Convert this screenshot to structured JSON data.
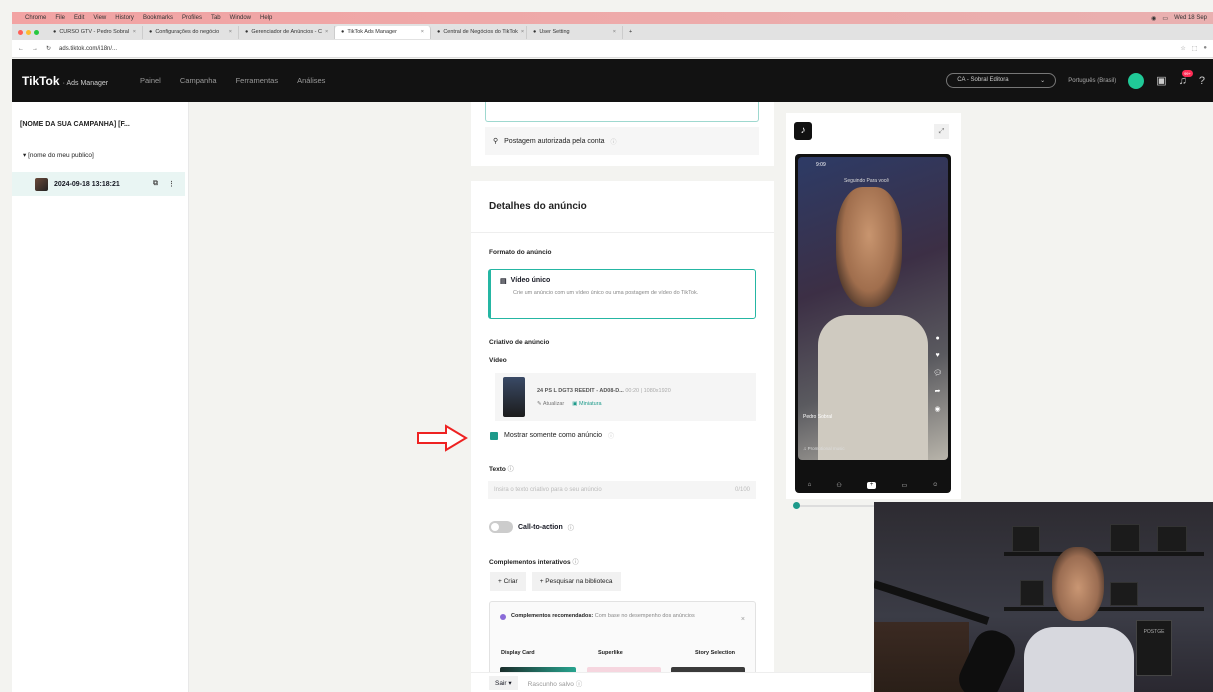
{
  "browser": {
    "menu": [
      "Chrome",
      "File",
      "Edit",
      "View",
      "History",
      "Bookmarks",
      "Profiles",
      "Tab",
      "Window",
      "Help"
    ],
    "clock": "Wed 18 Sep",
    "tabs": [
      {
        "label": "CURSO GTV - Pedro Sobral"
      },
      {
        "label": "Configurações do negócio"
      },
      {
        "label": "Gerenciador de Anúncios - C"
      },
      {
        "label": "TikTok Ads Manager",
        "active": true
      },
      {
        "label": "Central de Negócios do TikTok"
      },
      {
        "label": "User Setting"
      }
    ],
    "url": "ads.tiktok.com/i18n/..."
  },
  "header": {
    "brand": "TikTok",
    "sub": "· Ads Manager",
    "nav": [
      "Painel",
      "Campanha",
      "Ferramentas",
      "Análises"
    ],
    "account": "CA - Sobral Editora",
    "language": "Português (Brasil)",
    "notif_count": "99+"
  },
  "sidebar": {
    "campaign": "[NOME DA SUA CAMPANHA] [F...",
    "adgroup": "[nome do meu publico]",
    "ad": "2024-09-18 13:18:21"
  },
  "form": {
    "authorized_post": "Postagem autorizada pela conta",
    "section_title": "Detalhes do anúncio",
    "format_label": "Formato do anúncio",
    "format_option_title": "Vídeo único",
    "format_option_desc": "Crie um anúncio com um vídeo único ou uma postagem de vídeo do TikTok.",
    "creative_label": "Criativo de anúncio",
    "video_label": "Vídeo",
    "video_name": "24 PS L DGT3 REEDIT - AD08-D...",
    "video_dims": "00:20 | 1080x1920",
    "video_update": "Atualizar",
    "video_thumb": "Miniatura",
    "checkbox_label": "Mostrar somente como anúncio",
    "text_label": "Texto",
    "text_placeholder": "Insira o texto criativo para o seu anúncio",
    "text_count": "0/100",
    "cta_label": "Call-to-action",
    "interactive_label": "Complementos interativos",
    "create_btn": "+ Criar",
    "library_btn": "+ Pesquisar na biblioteca",
    "rec_title": "Complementos recomendados:",
    "rec_desc": "Com base no desempenho dos anúncios",
    "rec_options": [
      "Display Card",
      "Superlike",
      "Story Selection"
    ]
  },
  "footer": {
    "exit": "Sair",
    "saved": "Rascunho salvo"
  },
  "preview": {
    "time": "9:09",
    "feed_title": "Seguindo  Para você",
    "creator": "Pedro Sobral",
    "promo": "Promotional music"
  },
  "webcam": {
    "book_title": "POSTGE"
  }
}
